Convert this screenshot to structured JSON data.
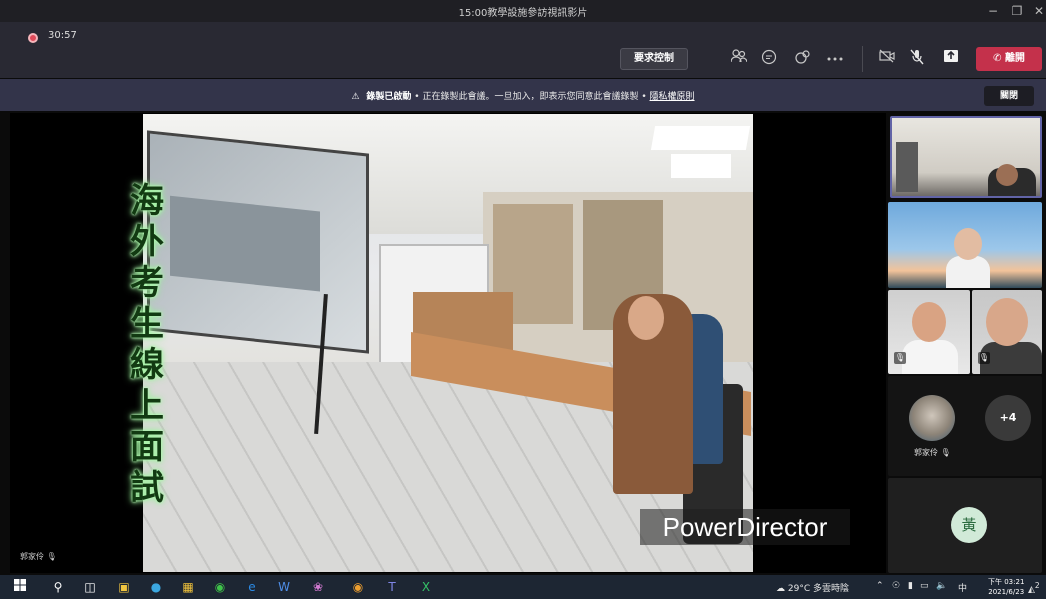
{
  "window": {
    "title": "15:00教學設施參訪視訊影片",
    "minimize": "−",
    "maximize": "❐",
    "close": "✕"
  },
  "toolbar": {
    "timer": "30:57",
    "request_control": "要求控制",
    "leave": "離開",
    "icons": [
      "participants-icon",
      "chat-icon",
      "reactions-icon",
      "more-icon",
      "camera-off-icon",
      "mic-off-icon",
      "share-icon"
    ]
  },
  "banner": {
    "title": "錄製已啟動",
    "message": "正在錄製此會議。一旦加入，即表示您同意此會議錄製 •",
    "link": "隱私權原則",
    "close_label": "關閉"
  },
  "stage": {
    "overlay_text": "海外考生線上面試",
    "watermark": "PowerDirector",
    "presenter_name": "郭家伶"
  },
  "participants": {
    "cat_name": "郭家伶",
    "more_count": "+4",
    "huang_initial": "黃"
  },
  "taskbar": {
    "weather": "29°C 多雲時陰",
    "ime": "中",
    "time": "下午 03:21",
    "date": "2021/6/23",
    "notif_count": "2"
  }
}
